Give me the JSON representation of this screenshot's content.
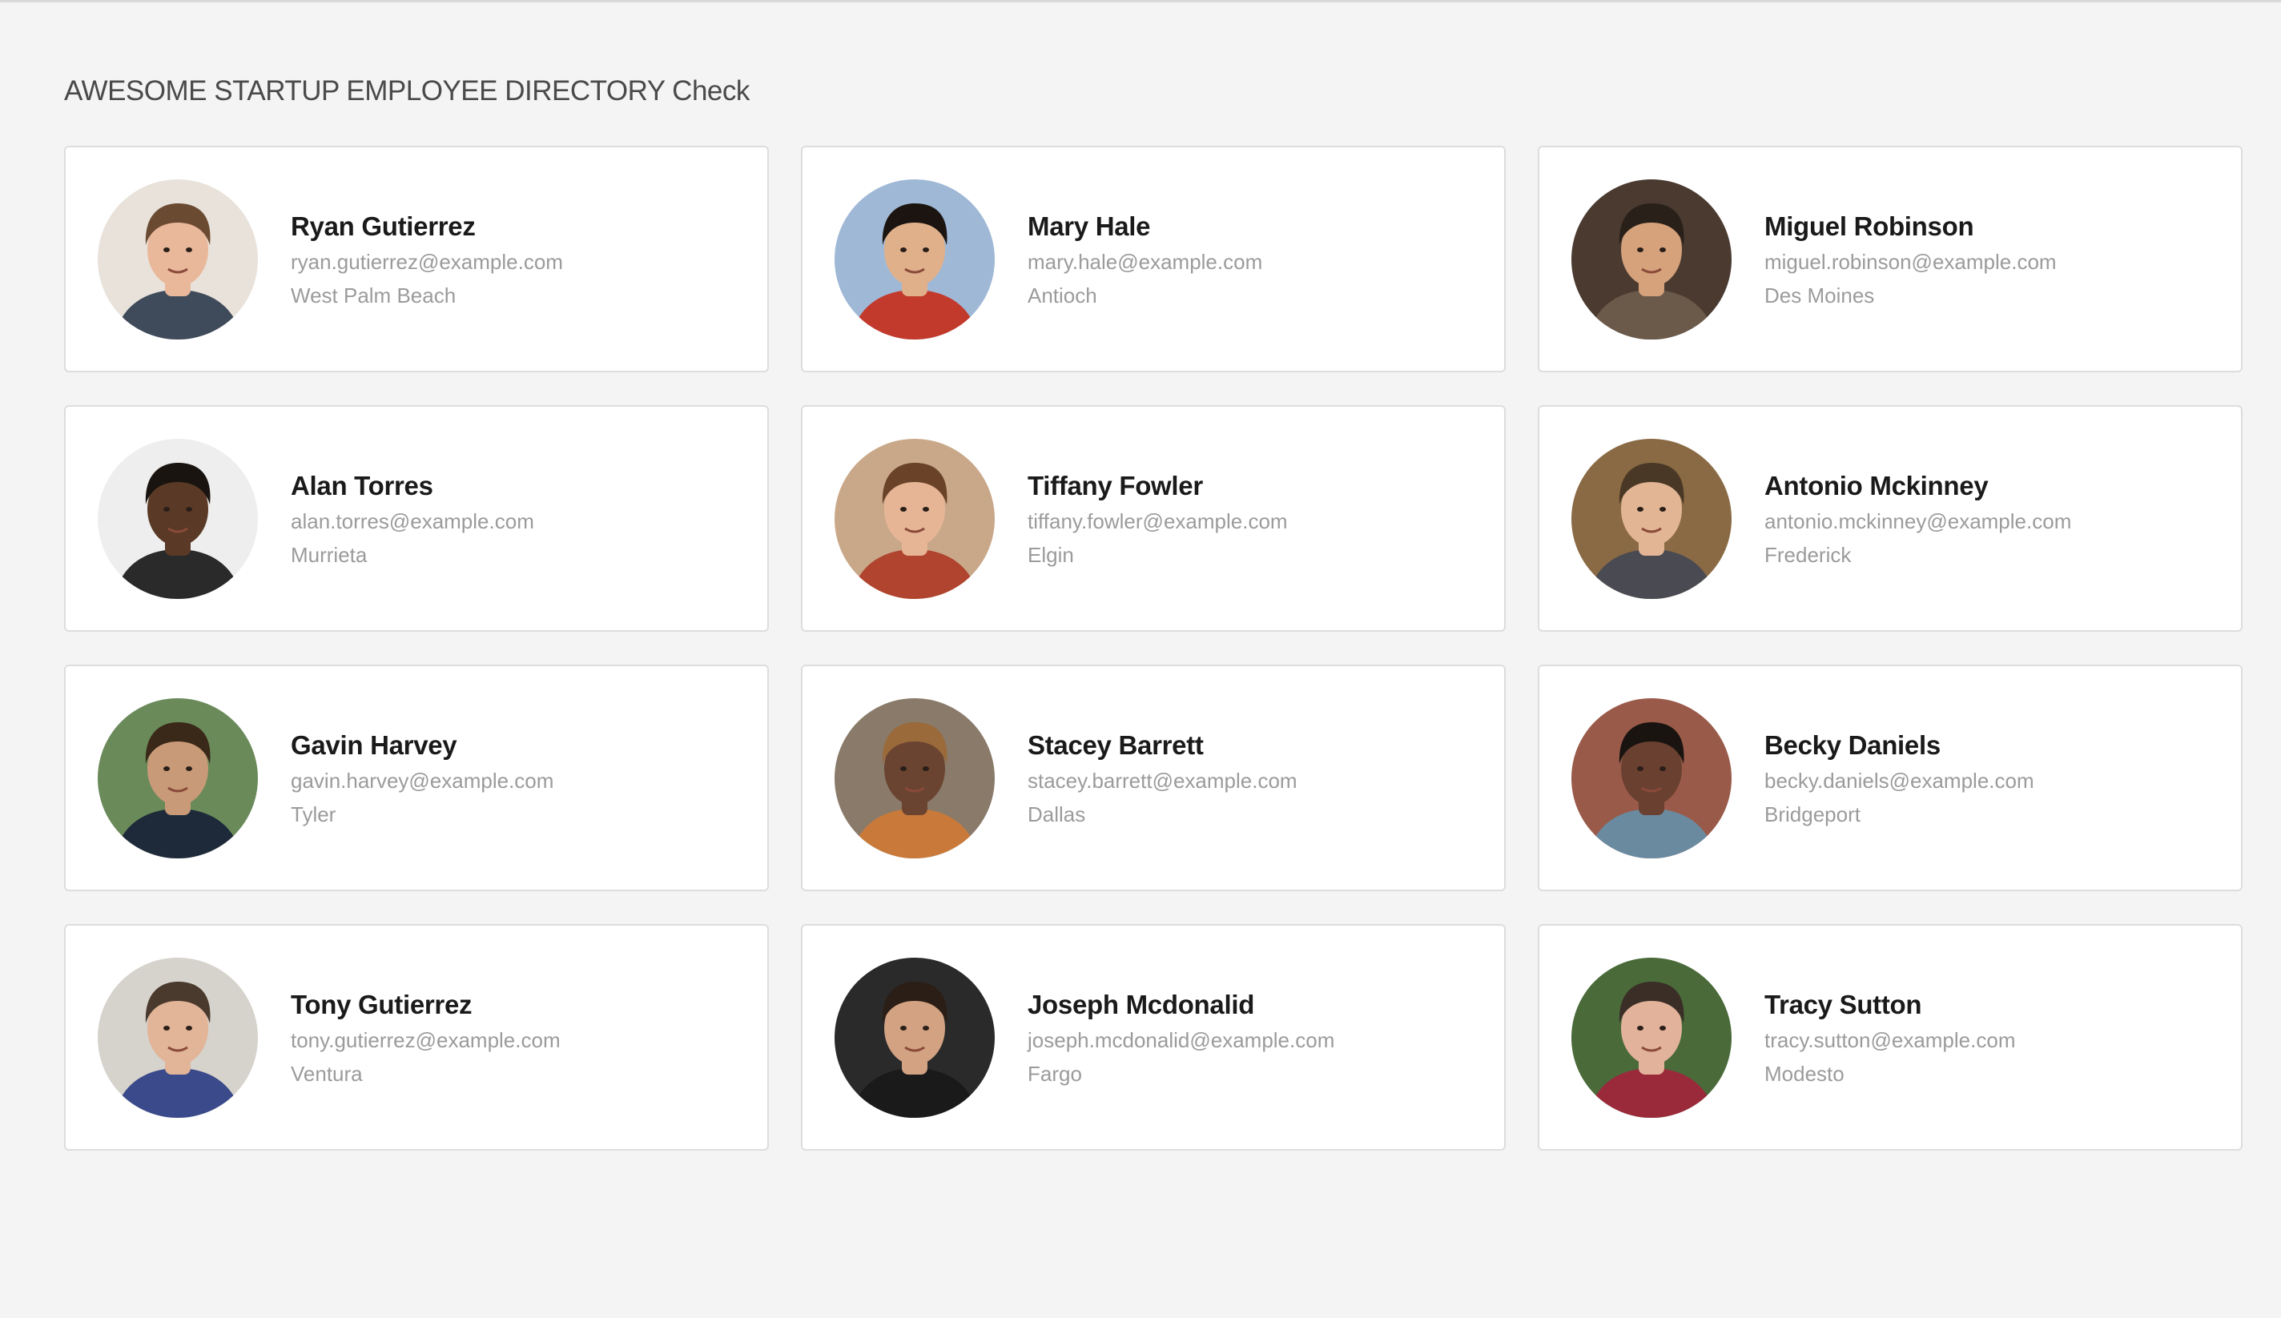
{
  "page": {
    "title": "AWESOME STARTUP EMPLOYEE DIRECTORY Check"
  },
  "employees": [
    {
      "name": "Ryan Gutierrez",
      "email": "ryan.gutierrez@example.com",
      "city": "West Palm Beach",
      "photo": {
        "bg": "#e8e2da",
        "skin": "#e9b89a",
        "hair": "#6b4a32",
        "shirt": "#3f4a5a"
      }
    },
    {
      "name": "Mary Hale",
      "email": "mary.hale@example.com",
      "city": "Antioch",
      "photo": {
        "bg": "#9fb8d6",
        "skin": "#e0b08a",
        "hair": "#1c1410",
        "shirt": "#c23a2c"
      }
    },
    {
      "name": "Miguel Robinson",
      "email": "miguel.robinson@example.com",
      "city": "Des Moines",
      "photo": {
        "bg": "#4a3a30",
        "skin": "#d6a27c",
        "hair": "#2a201a",
        "shirt": "#6b5a4a"
      }
    },
    {
      "name": "Alan Torres",
      "email": "alan.torres@example.com",
      "city": "Murrieta",
      "photo": {
        "bg": "#eeeeee",
        "skin": "#5a3a26",
        "hair": "#1a1410",
        "shirt": "#2a2a2a"
      }
    },
    {
      "name": "Tiffany Fowler",
      "email": "tiffany.fowler@example.com",
      "city": "Elgin",
      "photo": {
        "bg": "#c9a88a",
        "skin": "#e6b596",
        "hair": "#6a4228",
        "shirt": "#b0442e"
      }
    },
    {
      "name": "Antonio Mckinney",
      "email": "antonio.mckinney@example.com",
      "city": "Frederick",
      "photo": {
        "bg": "#8a6a44",
        "skin": "#e2b594",
        "hair": "#4a3826",
        "shirt": "#4a4a52"
      }
    },
    {
      "name": "Gavin Harvey",
      "email": "gavin.harvey@example.com",
      "city": "Tyler",
      "photo": {
        "bg": "#6a8a5a",
        "skin": "#c99a78",
        "hair": "#3a2818",
        "shirt": "#1e2a3a"
      }
    },
    {
      "name": "Stacey Barrett",
      "email": "stacey.barrett@example.com",
      "city": "Dallas",
      "photo": {
        "bg": "#8a7a6a",
        "skin": "#6a4430",
        "hair": "#9a6a3a",
        "shirt": "#c97a3a"
      }
    },
    {
      "name": "Becky Daniels",
      "email": "becky.daniels@example.com",
      "city": "Bridgeport",
      "photo": {
        "bg": "#9a5a4a",
        "skin": "#6a4030",
        "hair": "#1a1410",
        "shirt": "#6a8aa0"
      }
    },
    {
      "name": "Tony Gutierrez",
      "email": "tony.gutierrez@example.com",
      "city": "Ventura",
      "photo": {
        "bg": "#d6d2cc",
        "skin": "#e2b498",
        "hair": "#4a3a2e",
        "shirt": "#3a4a8a"
      }
    },
    {
      "name": "Joseph Mcdonalid",
      "email": "joseph.mcdonalid@example.com",
      "city": "Fargo",
      "photo": {
        "bg": "#2a2a2a",
        "skin": "#d2a282",
        "hair": "#2a1e16",
        "shirt": "#1a1a1a"
      }
    },
    {
      "name": "Tracy Sutton",
      "email": "tracy.sutton@example.com",
      "city": "Modesto",
      "photo": {
        "bg": "#4a6a3a",
        "skin": "#e2b29a",
        "hair": "#3a2e26",
        "shirt": "#9a2a3a"
      }
    }
  ]
}
